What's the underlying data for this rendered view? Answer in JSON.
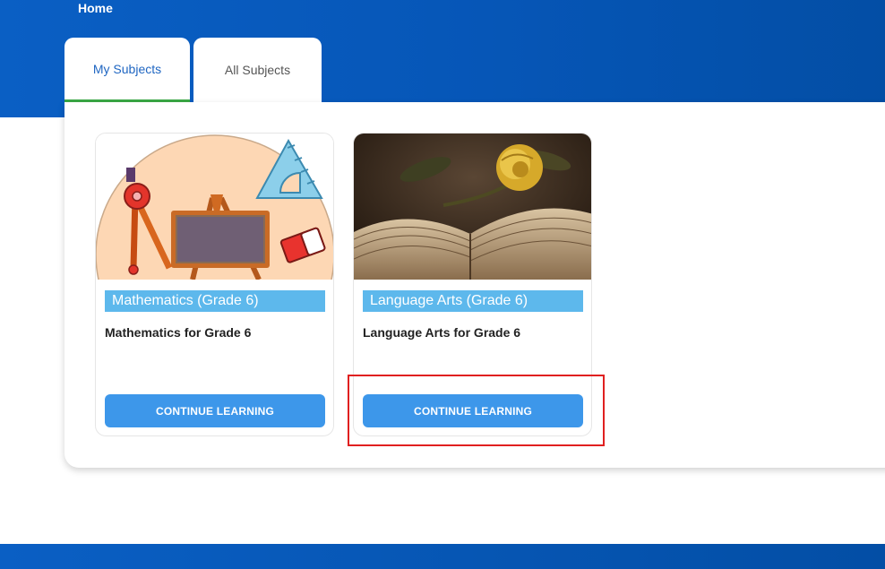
{
  "header": {
    "title": "Home"
  },
  "tabs": [
    {
      "label": "My Subjects",
      "active": true
    },
    {
      "label": "All Subjects",
      "active": false
    }
  ],
  "colors": {
    "header_blue": "#0656b7",
    "active_tab_text": "#1f66c2",
    "active_tab_underline": "#3aa845",
    "subject_tag": "#5db8ec",
    "button": "#3d97ea",
    "highlight": "#e02020"
  },
  "cards": [
    {
      "subject": "Mathematics (Grade 6)",
      "description": "Mathematics for Grade 6",
      "button_label": "CONTINUE LEARNING",
      "image_icon": "geometry-tools-illustration"
    },
    {
      "subject": "Language Arts (Grade 6)",
      "description": "Language Arts for Grade 6",
      "button_label": "CONTINUE LEARNING",
      "image_icon": "open-book-with-rose-photo"
    }
  ]
}
